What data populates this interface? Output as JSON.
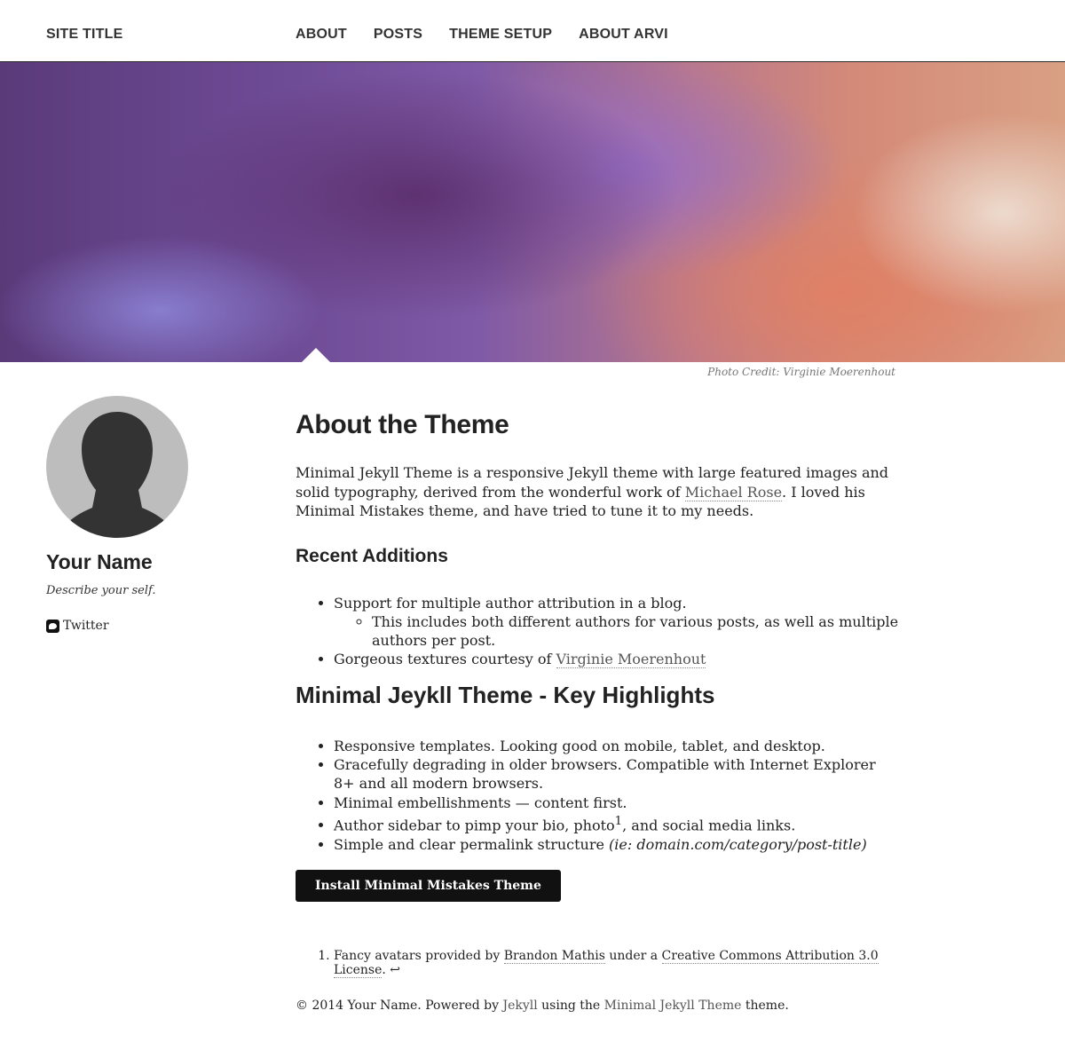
{
  "header": {
    "site_title": "SITE TITLE",
    "nav": [
      "ABOUT",
      "POSTS",
      "THEME SETUP",
      "ABOUT ARVI"
    ]
  },
  "hero": {
    "photo_credit_label": "Photo Credit:",
    "photo_credit_name": "Virginie Moerenhout"
  },
  "sidebar": {
    "author_name": "Your Name",
    "bio": "Describe your self.",
    "twitter_label": "Twitter"
  },
  "main": {
    "title": "About the Theme",
    "intro_before": "Minimal Jekyll Theme is a responsive Jekyll theme with large featured images and solid typography, derived from the wonderful work of ",
    "intro_link": "Michael Rose",
    "intro_after": ". I loved his Minimal Mistakes theme, and have tried to tune it to my needs.",
    "recent_heading": "Recent Additions",
    "recent_item1": "Support for multiple author attribution in a blog.",
    "recent_item1_sub": "This includes both different authors for various posts, as well as multiple authors per post.",
    "recent_item2_before": "Gorgeous textures courtesy of ",
    "recent_item2_link": "Virginie Moerenhout",
    "highlights_heading": "Minimal Jeykll Theme - Key Highlights",
    "highlight1": "Responsive templates. Looking good on mobile, tablet, and desktop.",
    "highlight2": "Gracefully degrading in older browsers. Compatible with Internet Explorer 8+ and all modern browsers.",
    "highlight3": "Minimal embellishments — content first.",
    "highlight4_before": "Author sidebar to pimp your bio, photo",
    "highlight4_sup": "1",
    "highlight4_after": ", and social media links.",
    "highlight5_before": "Simple and clear permalink structure ",
    "highlight5_em": "(ie: domain.com/category/post-title)",
    "button_label": "Install Minimal Mistakes Theme"
  },
  "footnote": {
    "before": "Fancy avatars provided by ",
    "link1": "Brandon Mathis",
    "middle": " under a ",
    "link2": "Creative Commons Attribution 3.0 License",
    "after": ".",
    "return_icon": "↩"
  },
  "footer": {
    "before": "© 2014 Your Name. Powered by ",
    "jekyll": "Jekyll",
    "middle": " using the ",
    "theme": "Minimal Jekyll Theme",
    "after": " theme."
  }
}
